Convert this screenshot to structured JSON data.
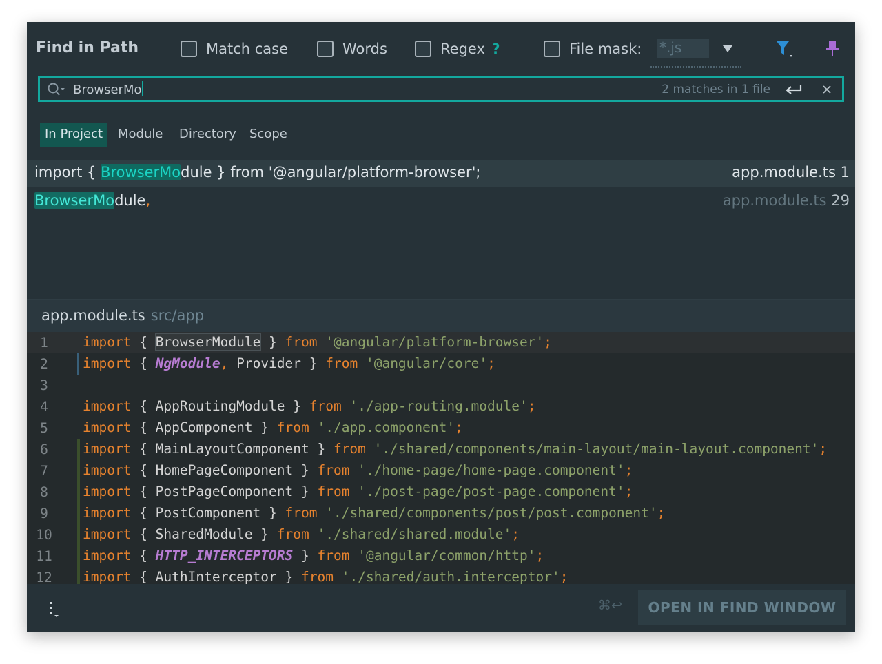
{
  "dialog": {
    "title": "Find in Path"
  },
  "options": {
    "match_case": {
      "label": "Match case",
      "checked": false
    },
    "words": {
      "label": "Words",
      "checked": false
    },
    "regex": {
      "label": "Regex",
      "checked": false,
      "help": "?"
    },
    "file_mask": {
      "label": "File mask:",
      "checked": false,
      "value": "*.js"
    }
  },
  "icons": {
    "filter": "filter-icon",
    "pin": "pin-icon",
    "search": "search-icon",
    "enter": "enter-icon",
    "clear": "close-icon",
    "dropdown": "chevron-down-icon",
    "menu": "more-vertical-icon"
  },
  "colors": {
    "accent": "#13a89e",
    "background": "#263238",
    "editor_bg": "#242a2c",
    "keyword": "#e6822e",
    "string": "#8da26a",
    "type_italic": "#b77cd2"
  },
  "search": {
    "query": "BrowserMo",
    "matches": "2 matches in 1 file"
  },
  "scopes": [
    {
      "label": "In Project",
      "active": true
    },
    {
      "label": "Module",
      "active": false
    },
    {
      "label": "Directory",
      "active": false
    },
    {
      "label": "Scope",
      "active": false
    }
  ],
  "results": [
    {
      "pre": "import { ",
      "match": "BrowserMo",
      "post": "dule } from '@angular/platform-browser';",
      "file": "app.module.ts",
      "line": "1",
      "selected": true
    },
    {
      "pre": "",
      "match": "BrowserMo",
      "post": "dule",
      "trail": ",",
      "file": "app.module.ts",
      "line": "29",
      "selected": false
    }
  ],
  "preview": {
    "file": "app.module.ts",
    "path": "src/app",
    "lines": [
      {
        "n": "1",
        "tokens": [
          [
            "kw",
            "import"
          ],
          [
            "t",
            " { "
          ],
          [
            "occ",
            "BrowserModule"
          ],
          [
            "t",
            " } "
          ],
          [
            "kw",
            "from"
          ],
          [
            "t",
            " "
          ],
          [
            "str",
            "'@angular/platform-browser'"
          ],
          [
            "p",
            ";"
          ]
        ]
      },
      {
        "n": "2",
        "tokens": [
          [
            "kw",
            "import"
          ],
          [
            "t",
            " { "
          ],
          [
            "it",
            "NgModule"
          ],
          [
            "p",
            ","
          ],
          [
            "t",
            " Provider } "
          ],
          [
            "kw",
            "from"
          ],
          [
            "t",
            " "
          ],
          [
            "str",
            "'@angular/core'"
          ],
          [
            "p",
            ";"
          ]
        ]
      },
      {
        "n": "3",
        "tokens": []
      },
      {
        "n": "4",
        "tokens": [
          [
            "kw",
            "import"
          ],
          [
            "t",
            " { AppRoutingModule } "
          ],
          [
            "kw",
            "from"
          ],
          [
            "t",
            " "
          ],
          [
            "str",
            "'./app-routing.module'"
          ],
          [
            "p",
            ";"
          ]
        ]
      },
      {
        "n": "5",
        "tokens": [
          [
            "kw",
            "import"
          ],
          [
            "t",
            " { AppComponent } "
          ],
          [
            "kw",
            "from"
          ],
          [
            "t",
            " "
          ],
          [
            "str",
            "'./app.component'"
          ],
          [
            "p",
            ";"
          ]
        ]
      },
      {
        "n": "6",
        "tokens": [
          [
            "kw",
            "import"
          ],
          [
            "t",
            " { MainLayoutComponent } "
          ],
          [
            "kw",
            "from"
          ],
          [
            "t",
            " "
          ],
          [
            "str",
            "'./shared/components/main-layout/main-layout.component'"
          ],
          [
            "p",
            ";"
          ]
        ]
      },
      {
        "n": "7",
        "tokens": [
          [
            "kw",
            "import"
          ],
          [
            "t",
            " { HomePageComponent } "
          ],
          [
            "kw",
            "from"
          ],
          [
            "t",
            " "
          ],
          [
            "str",
            "'./home-page/home-page.component'"
          ],
          [
            "p",
            ";"
          ]
        ]
      },
      {
        "n": "8",
        "tokens": [
          [
            "kw",
            "import"
          ],
          [
            "t",
            " { PostPageComponent } "
          ],
          [
            "kw",
            "from"
          ],
          [
            "t",
            " "
          ],
          [
            "str",
            "'./post-page/post-page.component'"
          ],
          [
            "p",
            ";"
          ]
        ]
      },
      {
        "n": "9",
        "tokens": [
          [
            "kw",
            "import"
          ],
          [
            "t",
            " { PostComponent } "
          ],
          [
            "kw",
            "from"
          ],
          [
            "t",
            " "
          ],
          [
            "str",
            "'./shared/components/post/post.component'"
          ],
          [
            "p",
            ";"
          ]
        ]
      },
      {
        "n": "10",
        "tokens": [
          [
            "kw",
            "import"
          ],
          [
            "t",
            " { SharedModule } "
          ],
          [
            "kw",
            "from"
          ],
          [
            "t",
            " "
          ],
          [
            "str",
            "'./shared/shared.module'"
          ],
          [
            "p",
            ";"
          ]
        ]
      },
      {
        "n": "11",
        "tokens": [
          [
            "kw",
            "import"
          ],
          [
            "t",
            " { "
          ],
          [
            "it",
            "HTTP_INTERCEPTORS"
          ],
          [
            "t",
            " } "
          ],
          [
            "kw",
            "from"
          ],
          [
            "t",
            " "
          ],
          [
            "str",
            "'@angular/common/http'"
          ],
          [
            "p",
            ";"
          ]
        ]
      },
      {
        "n": "12",
        "tokens": [
          [
            "kw",
            "import"
          ],
          [
            "t",
            " { AuthInterceptor } "
          ],
          [
            "kw",
            "from"
          ],
          [
            "t",
            " "
          ],
          [
            "str",
            "'./shared/auth.interceptor'"
          ],
          [
            "p",
            ";"
          ]
        ]
      }
    ]
  },
  "footer": {
    "shortcut": "⌘↩",
    "open_button": "OPEN IN FIND WINDOW"
  }
}
